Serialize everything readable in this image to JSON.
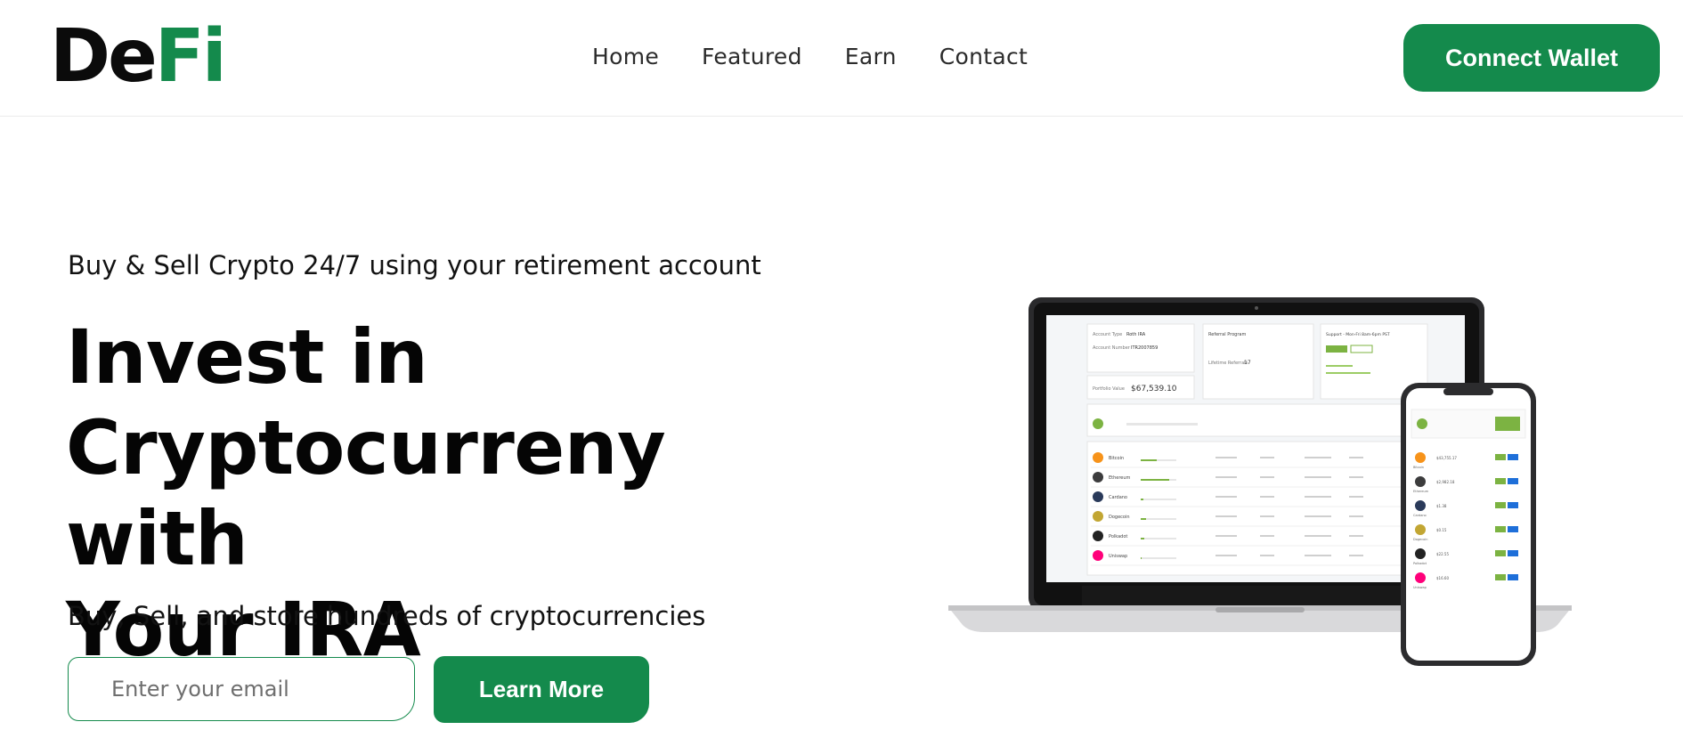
{
  "brand": {
    "logo_part1": "De",
    "logo_part2": "Fi",
    "accent": "#148a4c"
  },
  "nav": {
    "items": [
      "Home",
      "Featured",
      "Earn",
      "Contact"
    ]
  },
  "header": {
    "connect_label": "Connect Wallet"
  },
  "hero": {
    "kicker": "Buy & Sell Crypto 24/7 using your retirement account",
    "title_line1": "Invest in",
    "title_line2": "Cryptocurreny with",
    "title_line3": "Your IRA",
    "subtitle": "Buy, Sell, and store hundreds of cryptocurrencies",
    "email_placeholder": "Enter your email",
    "learn_label": "Learn More"
  },
  "illustration": {
    "laptop_screen": {
      "account_type_label": "Account Type",
      "account_type": "Roth IRA",
      "account_number_label": "Account Number",
      "account_number": "ITR2007859",
      "portfolio_label": "Portfolio Value",
      "portfolio_value": "$67,539.10",
      "referral_title": "Referral Program",
      "lifetime_label": "Lifetime Referrals",
      "lifetime_value": "17",
      "support_title": "Support - Mon-Fri 8am-6pm PST",
      "assets": [
        {
          "name": "Bitcoin",
          "color": "#f7931a"
        },
        {
          "name": "Ethereum",
          "color": "#3c3c3d"
        },
        {
          "name": "Cardano",
          "color": "#2a3a5a"
        },
        {
          "name": "Dogecoin",
          "color": "#c2a633"
        },
        {
          "name": "Polkadot",
          "color": "#222222"
        },
        {
          "name": "Uniswap",
          "color": "#ff007a"
        }
      ]
    },
    "phone_screen": {
      "assets": [
        {
          "name": "Bitcoin",
          "price": "$43,755.17",
          "color": "#f7931a"
        },
        {
          "name": "Ethereum",
          "price": "$2,982.18",
          "color": "#3c3c3d"
        },
        {
          "name": "Cardano",
          "price": "$1.38",
          "color": "#2a3a5a"
        },
        {
          "name": "Dogecoin",
          "price": "$0.15",
          "color": "#c2a633"
        },
        {
          "name": "Polkadot",
          "price": "$22.55",
          "color": "#222222"
        },
        {
          "name": "Uniswap",
          "price": "$16.60",
          "color": "#ff007a"
        }
      ]
    }
  }
}
